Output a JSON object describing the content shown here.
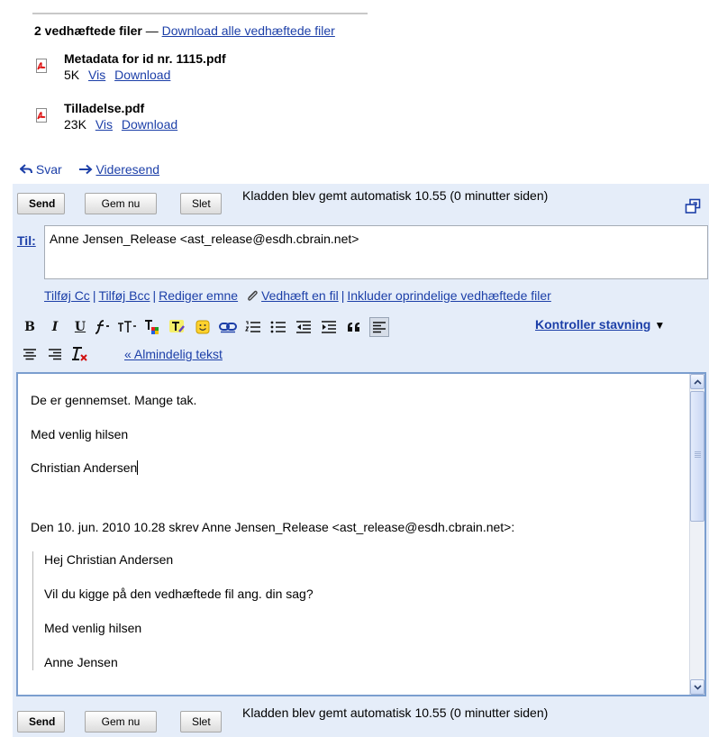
{
  "attachments": {
    "count_text": "2 vedhæftede filer",
    "dash": " — ",
    "download_all": "Download alle vedhæftede filer",
    "files": [
      {
        "name": "Metadata for id nr. 1115.pdf",
        "size": "5K",
        "view": "Vis",
        "download": "Download",
        "icon": "pdf-icon"
      },
      {
        "name": "Tilladelse.pdf",
        "size": "23K",
        "view": "Vis",
        "download": "Download",
        "icon": "pdf-icon"
      }
    ]
  },
  "reply_bar": {
    "reply": "Svar",
    "forward": "Videresend"
  },
  "compose": {
    "top": {
      "send": "Send",
      "save": "Gem nu",
      "delete": "Slet",
      "status": "Kladden blev gemt automatisk 10.55 (0 minutter siden)"
    },
    "bottom": {
      "send": "Send",
      "save": "Gem nu",
      "delete": "Slet",
      "status": "Kladden blev gemt automatisk 10.55 (0 minutter siden)"
    },
    "to_label": "Til:",
    "to_value": "Anne Jensen_Release <ast_release@esdh.cbrain.net>",
    "links": {
      "add_cc": "Tilføj Cc",
      "add_bcc": "Tilføj Bcc",
      "edit_subject": "Rediger emne",
      "attach": "Vedhæft en fil",
      "include_attachments": "Inkluder oprindelige vedhæftede filer",
      "separator": "|"
    },
    "toolbar": {
      "bold": "B",
      "italic": "I",
      "underline": "U",
      "spellcheck": "Kontroller stavning",
      "plain_text": "« Almindelig tekst"
    },
    "body": {
      "line1": "De er gennemset. Mange tak.",
      "line2": "Med venlig hilsen",
      "line3": "Christian Andersen",
      "quote_header": "Den 10. jun. 2010 10.28 skrev Anne Jensen_Release <ast_release@esdh.cbrain.net>:",
      "quote_line1": "Hej Christian Andersen",
      "quote_line2": "Vil du kigge på den vedhæftede fil ang. din sag?",
      "quote_line3": "Med venlig hilsen",
      "quote_line4": "Anne Jensen"
    }
  },
  "colors": {
    "link": "#1c3fa8",
    "panel": "#e5edf9",
    "editor_border": "#7b9ecf"
  }
}
